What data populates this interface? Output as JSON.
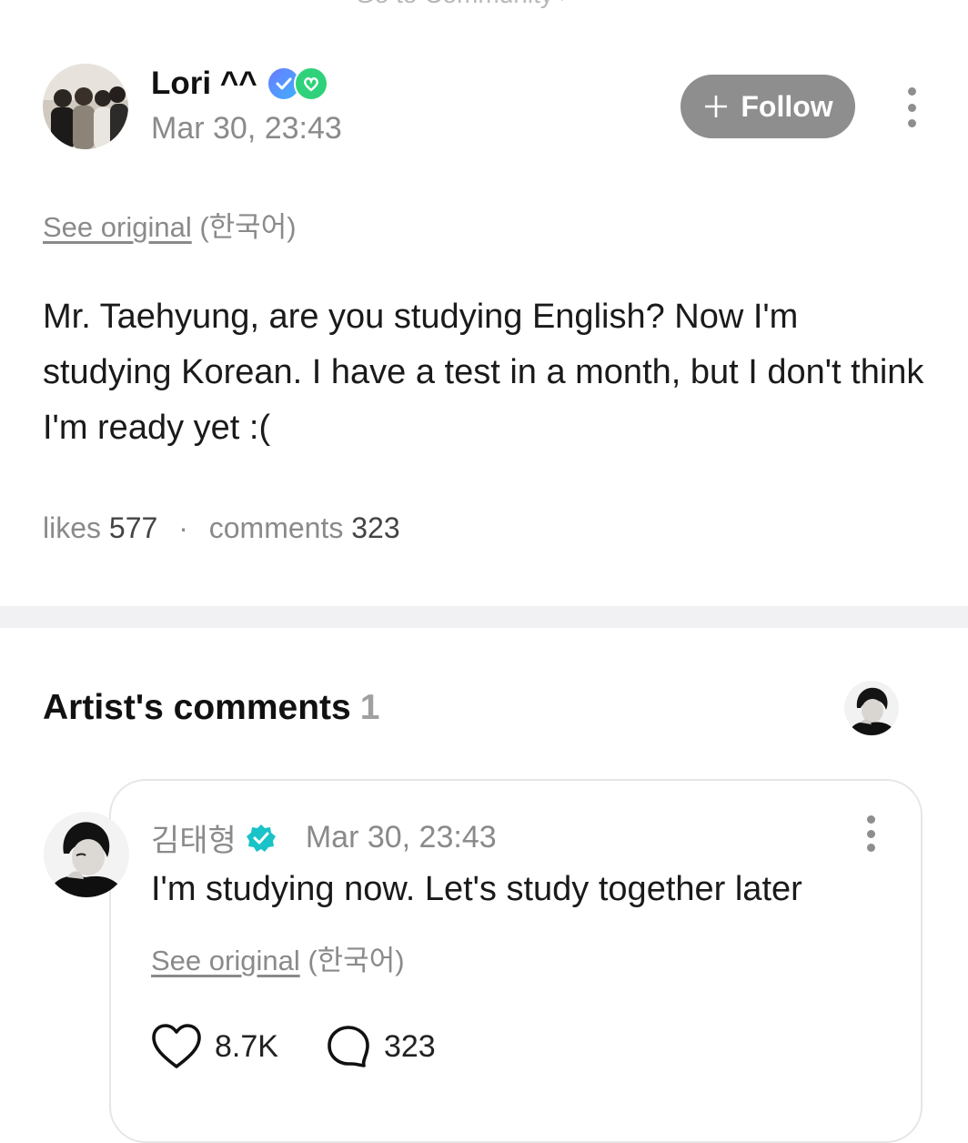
{
  "top_link": {
    "label": "Go to Community >"
  },
  "post": {
    "author": "Lori ^^",
    "date": "Mar 30, 23:43",
    "follow_label": "Follow",
    "see_original_label": "See original",
    "original_language": "(한국어)",
    "body": "Mr. Taehyung, are you studying English? Now I'm studying Korean. I have a test in a month, but I don't think I'm ready yet :(",
    "likes_label": "likes",
    "likes_count": "577",
    "stats_separator": "·",
    "comments_label": "comments",
    "comments_count": "323"
  },
  "artist_comments": {
    "title": "Artist's comments",
    "count": "1",
    "comment": {
      "author": "김태형",
      "date": "Mar 30, 23:43",
      "text": "I'm studying now. Let's study together later",
      "see_original_label": "See original",
      "original_language": "(한국어)",
      "likes": "8.7K",
      "replies": "323"
    }
  },
  "icons": {
    "badge_1": "membership-badge-icon",
    "badge_2": "fan-badge-icon",
    "verified": "verified-check-icon",
    "like": "heart-outline-icon",
    "comment": "speech-bubble-icon",
    "more": "more-vertical-icon"
  },
  "colors": {
    "follow_bg": "#8e8e8e",
    "verified": "#19c3c8",
    "badge_blue": "#5a7cff",
    "badge_green": "#2fd27a",
    "muted_text": "#8a8a8a"
  }
}
